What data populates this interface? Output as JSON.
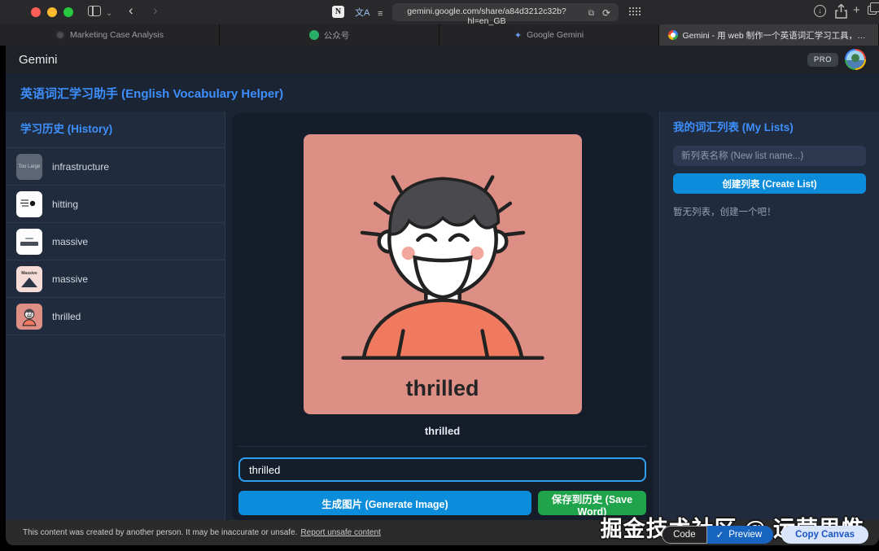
{
  "chrome": {
    "url": "gemini.google.com/share/a84d3212c32b?hl=en_GB",
    "icons": {
      "back": "‹",
      "forward": "›",
      "chevron": "⌄",
      "reload": "⟳",
      "plus": "+",
      "translate": "文A",
      "reader": "≡",
      "url_badge": "⧉",
      "download_arrow": "↓",
      "notion": "N"
    }
  },
  "tabs": [
    {
      "label": "Marketing Case Analysis"
    },
    {
      "label": "公众号"
    },
    {
      "label": "Google Gemini"
    },
    {
      "label": "Gemini - 用 web 制作一个英语词汇学习工具，功能是可以让用户输入单词…"
    }
  ],
  "header": {
    "brand": "Gemini",
    "pro": "PRO"
  },
  "app": {
    "title": "英语词汇学习助手 (English Vocabulary Helper)",
    "history": {
      "heading": "学习历史 (History)",
      "items": [
        {
          "label": "infrastructure",
          "thumb_text": "Too Large"
        },
        {
          "label": "hitting"
        },
        {
          "label": "massive"
        },
        {
          "label": "massive",
          "thumb_text": "Massive"
        },
        {
          "label": "thrilled"
        }
      ]
    },
    "main": {
      "image_word": "thrilled",
      "caption": "thrilled",
      "input_value": "thrilled",
      "generate_label": "生成图片 (Generate Image)",
      "save_label": "保存到历史 (Save Word)"
    },
    "lists": {
      "heading": "我的词汇列表 (My Lists)",
      "placeholder": "新列表名称 (New list name...)",
      "create_label": "创建列表 (Create List)",
      "empty": "暂无列表，创建一个吧！"
    }
  },
  "footer": {
    "disclaimer": "This content was created by another person. It may be inaccurate or unsafe.",
    "report_link": "Report unsafe content",
    "code_label": "Code",
    "preview_label": "Preview",
    "preview_check": "✓",
    "copy_canvas_label": "Copy Canvas"
  },
  "watermark": "掘金技术社区 @ 运营思惟",
  "colors": {
    "accent_blue": "#3e8ffd",
    "button_blue": "#0c8ddb",
    "button_green": "#1fa34b",
    "image_bg": "#dd8f85",
    "shirt": "#ef7a5f",
    "input_border": "#2da0f2"
  }
}
